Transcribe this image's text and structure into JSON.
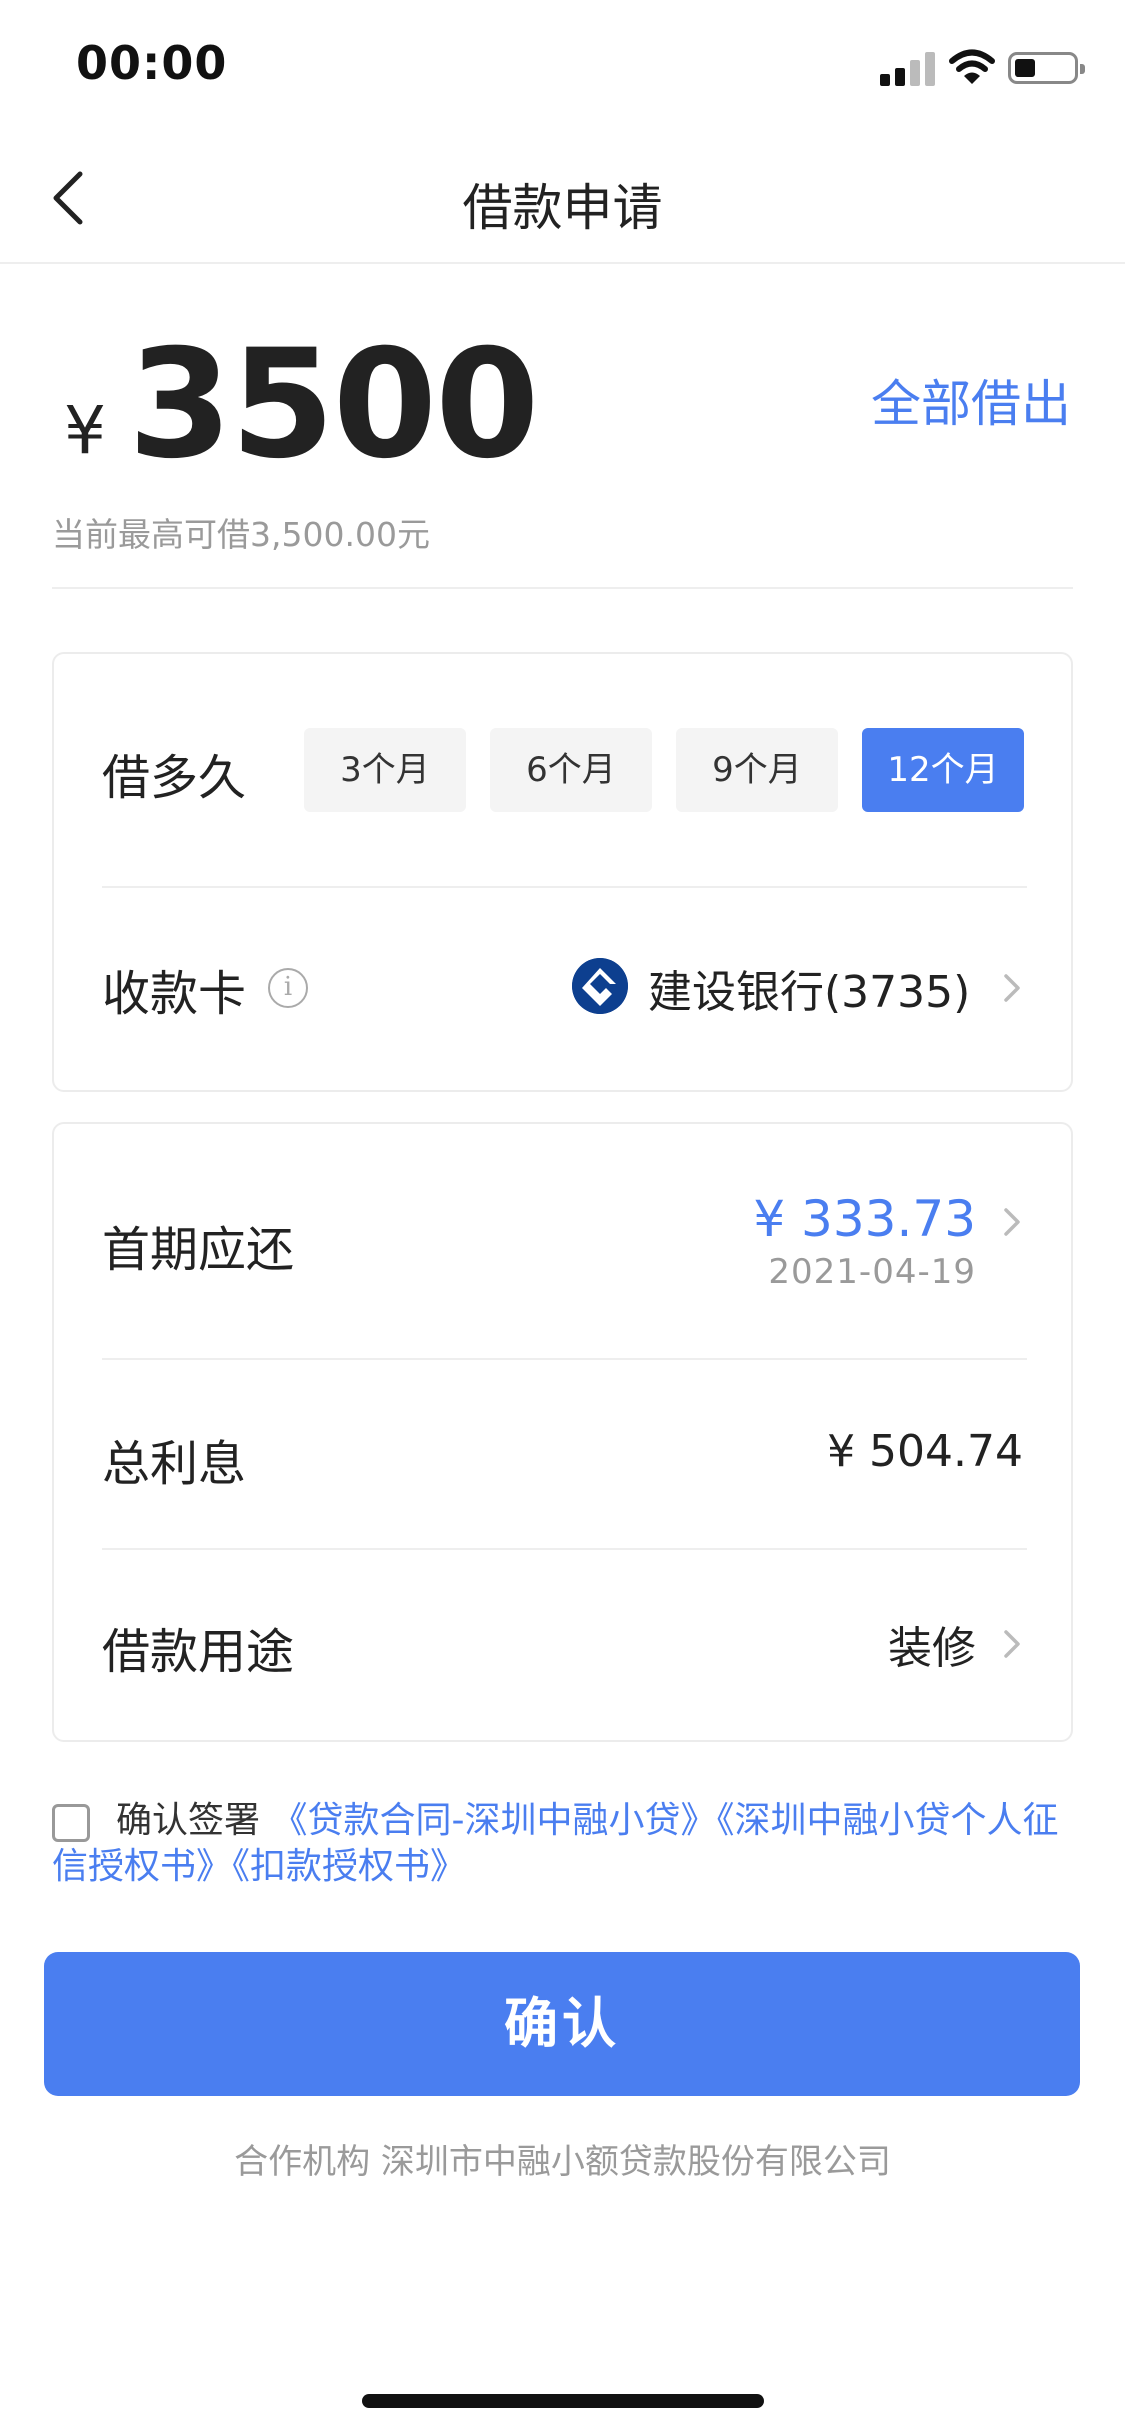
{
  "status_bar": {
    "time": "00:00"
  },
  "nav": {
    "title": "借款申请"
  },
  "amount": {
    "currency": "¥",
    "value": "3500",
    "borrow_all_label": "全部借出",
    "max_note": "当前最高可借3,500.00元"
  },
  "term": {
    "label": "借多久",
    "options": [
      "3个月",
      "6个月",
      "9个月",
      "12个月"
    ],
    "selected": "12个月"
  },
  "card": {
    "label": "收款卡",
    "bank": "建设银行(3735)"
  },
  "repayment": {
    "first_label": "首期应还",
    "first_amount": "¥  333.73",
    "first_date": "2021-04-19",
    "interest_label": "总利息",
    "interest_value": "¥  504.74",
    "purpose_label": "借款用途",
    "purpose_value": "装修"
  },
  "agreement": {
    "prefix": "确认签署 ",
    "links": [
      "《贷款合同-深圳中融小贷》",
      "《深圳中融小贷个人征信授权书》",
      "《扣款授权书》"
    ]
  },
  "confirm_label": "确认",
  "partner": "合作机构 深圳市中融小额贷款股份有限公司",
  "colors": {
    "accent": "#4a7ef0",
    "bank_logo": "#0d3f8f"
  }
}
